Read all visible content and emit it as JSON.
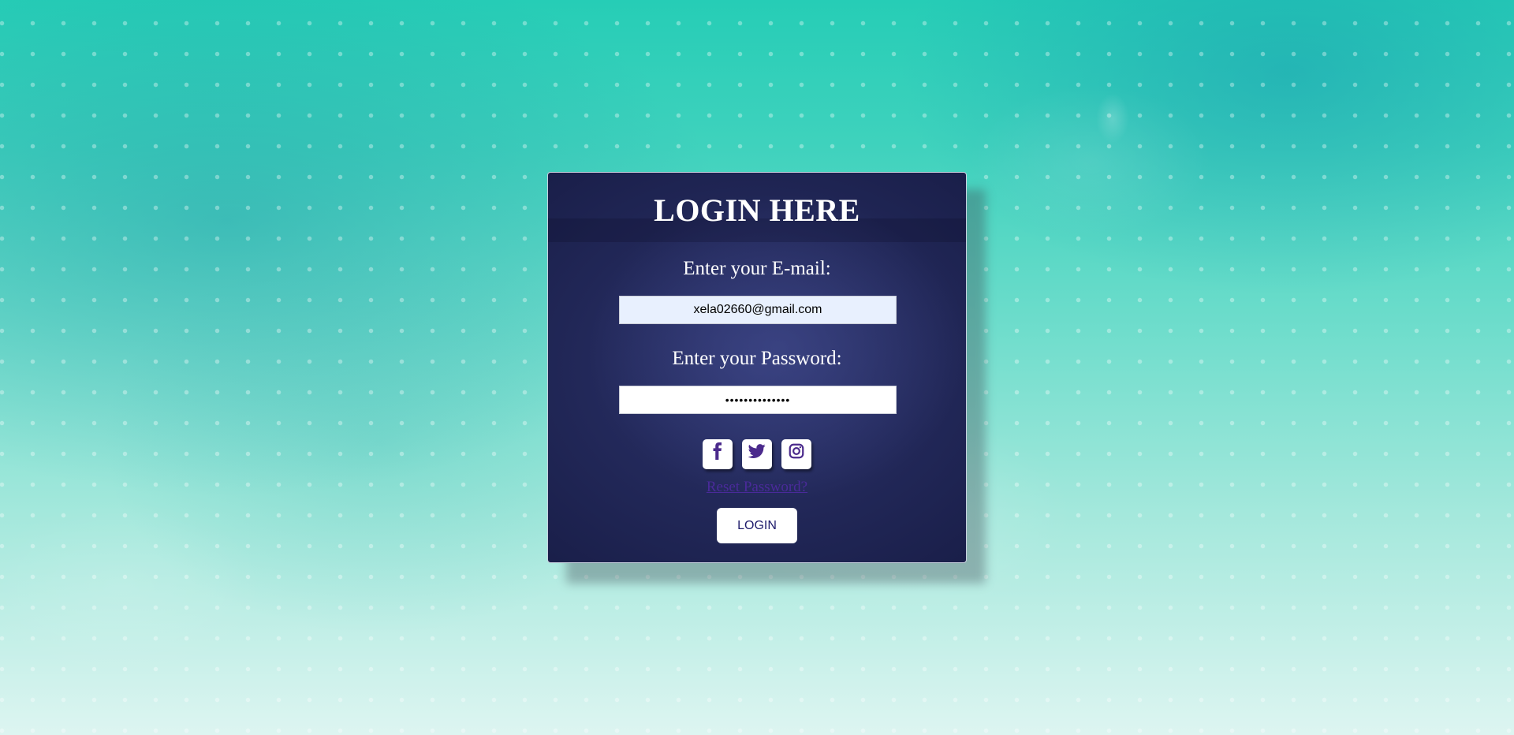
{
  "login_card": {
    "title": "LOGIN HERE",
    "email_label": "Enter your E-mail:",
    "email_value": "xela02660@gmail.com",
    "password_label": "Enter your Password:",
    "password_value": "••••••••••••••",
    "social_icons": [
      "facebook-icon",
      "twitter-icon",
      "instagram-icon"
    ],
    "reset_link": "Reset Password?",
    "login_button": "LOGIN"
  },
  "colors": {
    "card_background": "#1f2555",
    "accent_purple": "#4a2a9a",
    "button_text": "#1e1b6b",
    "background_teal": "#26cdb6"
  }
}
